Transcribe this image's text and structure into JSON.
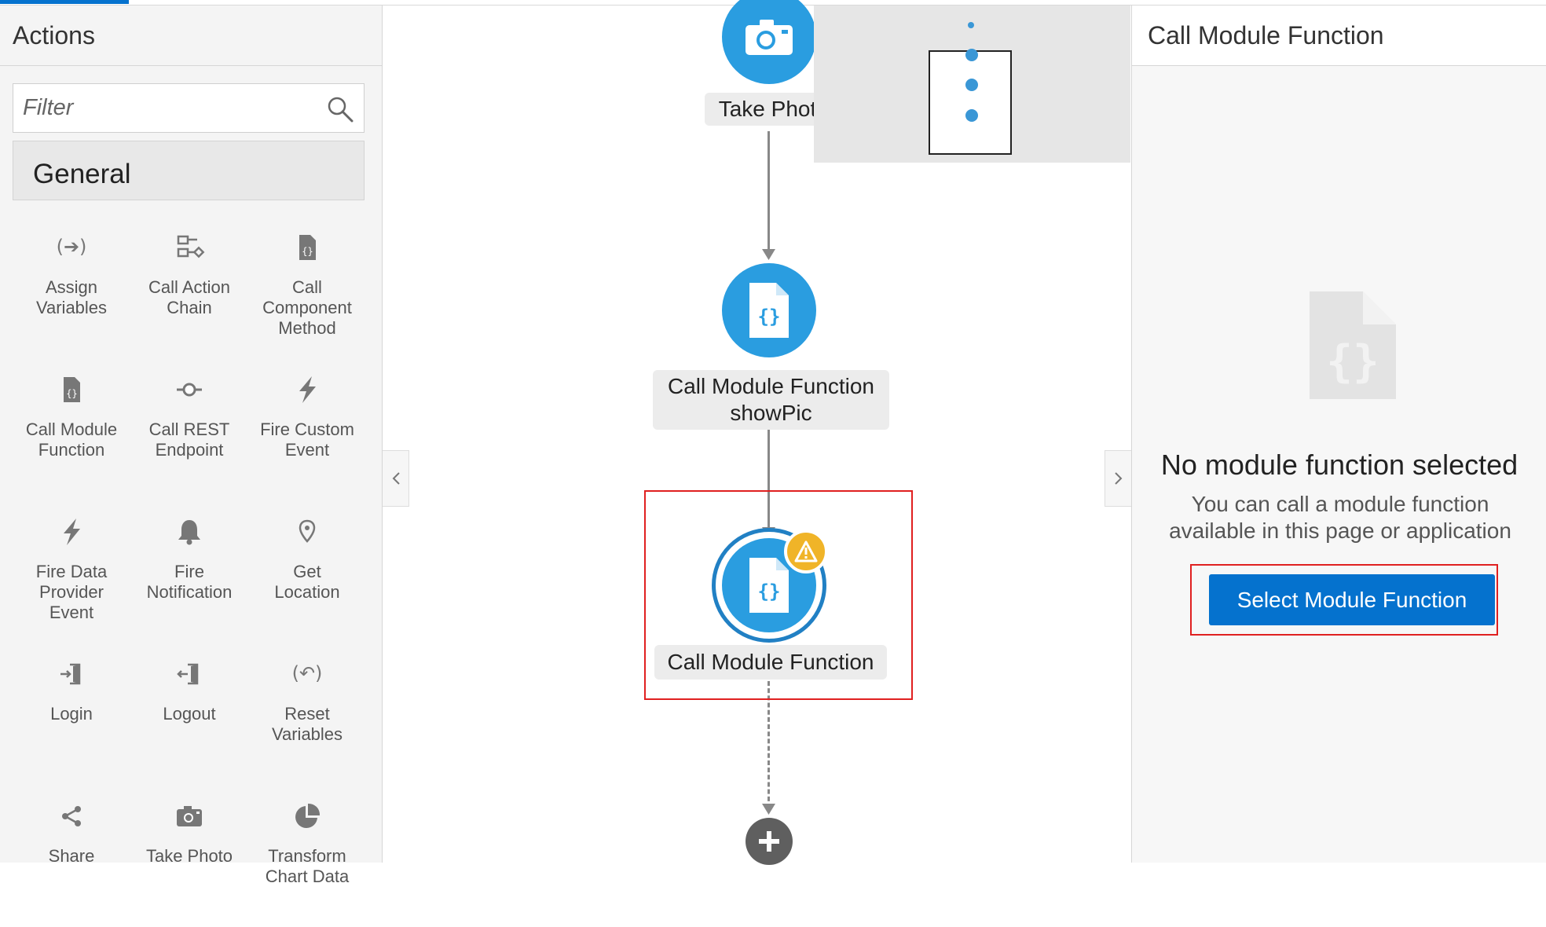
{
  "left_panel": {
    "title": "Actions",
    "filter_placeholder": "Filter",
    "section": "General",
    "actions": [
      {
        "label": "Assign\nVariables",
        "icon": "assign-variables-icon"
      },
      {
        "label": "Call Action\nChain",
        "icon": "call-action-chain-icon"
      },
      {
        "label": "Call\nComponent\nMethod",
        "icon": "file-code-icon"
      },
      {
        "label": "Call Module\nFunction",
        "icon": "file-code-icon"
      },
      {
        "label": "Call REST\nEndpoint",
        "icon": "rest-endpoint-icon"
      },
      {
        "label": "Fire Custom\nEvent",
        "icon": "lightning-icon"
      },
      {
        "label": "Fire Data\nProvider\nEvent",
        "icon": "lightning-icon"
      },
      {
        "label": "Fire\nNotification",
        "icon": "bell-icon"
      },
      {
        "label": "Get\nLocation",
        "icon": "location-pin-icon"
      },
      {
        "label": "Login",
        "icon": "login-icon"
      },
      {
        "label": "Logout",
        "icon": "logout-icon"
      },
      {
        "label": "Reset\nVariables",
        "icon": "reset-variables-icon"
      },
      {
        "label": "Share",
        "icon": "share-icon"
      },
      {
        "label": "Take Photo",
        "icon": "camera-icon"
      },
      {
        "label": "Transform\nChart Data",
        "icon": "pie-chart-icon"
      }
    ]
  },
  "canvas": {
    "nodes": [
      {
        "label": "Take Phot",
        "icon": "camera-icon"
      },
      {
        "label": "Call Module Function\nshowPic",
        "icon": "file-code-icon"
      },
      {
        "label": "Call Module Function",
        "icon": "file-code-icon",
        "warning": true
      }
    ]
  },
  "right_panel": {
    "title": "Call Module Function",
    "empty_title": "No module function selected",
    "empty_subtitle": "You can call a module function available in this page or application",
    "select_button": "Select Module Function"
  },
  "colors": {
    "accent": "#0572ce",
    "node_blue": "#2a9de0",
    "warning": "#f0b428",
    "highlight_red": "#e02020"
  }
}
